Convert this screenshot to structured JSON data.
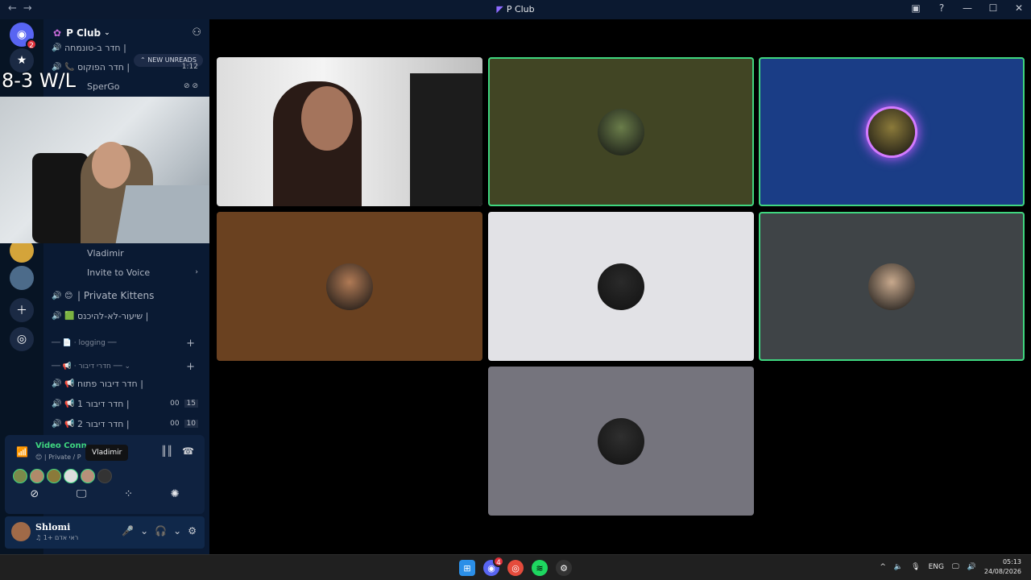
{
  "window": {
    "title": "P Club",
    "logo_icon": "discord-logo-icon"
  },
  "titlebar": {
    "back": "←",
    "forward": "→",
    "inbox_icon": "inbox-icon",
    "help_icon": "help-icon",
    "minimize": "—",
    "maximize": "☐",
    "close": "✕"
  },
  "rail": {
    "home_badge": "2"
  },
  "server": {
    "name": "P Club"
  },
  "new_unreads": "NEW UNREADS",
  "channels_top": [
    {
      "name": "חדר ב-טונמחה |",
      "right": ""
    },
    {
      "name": "חדר הפוקוס |",
      "right": "1:12"
    },
    {
      "name": "SperGo",
      "right": ""
    }
  ],
  "voice_members": [
    {
      "name": "Vladimir"
    },
    {
      "name": "Invite to Voice"
    }
  ],
  "channels_mid": [
    {
      "emoji": "😊",
      "name": "| Private Kittens"
    },
    {
      "emoji": "🟩",
      "name": "שיעור-לא-להיכנס |"
    }
  ],
  "categories": [
    {
      "name": "logging"
    },
    {
      "name": "חדרי דיבור"
    }
  ],
  "channels_bottom": [
    {
      "name": "חדר דיבור פתוח |",
      "a": "",
      "b": ""
    },
    {
      "name": "חדר דיבור 1 |",
      "a": "00",
      "b": "15"
    },
    {
      "name": "חדר דיבור 2 |",
      "a": "00",
      "b": "10"
    }
  ],
  "voice_panel": {
    "title": "Video Conn",
    "subtitle": "😊 | Private / P",
    "tooltip": "Vladimir"
  },
  "user": {
    "name": "Shlomi",
    "status": "♫ ראי אדם +1"
  },
  "overlay": {
    "text": "8-3 W/L"
  },
  "tiles": [
    {
      "type": "camera",
      "bg": "#d8d8d8"
    },
    {
      "type": "avatar",
      "bg": "#414524",
      "speaking": true,
      "avatar_color": "#6a7d4a"
    },
    {
      "type": "avatar",
      "bg": "#1a3d86",
      "speaking": true,
      "ring": true,
      "avatar_color": "#8b7a3a"
    },
    {
      "type": "avatar",
      "bg": "#6a4120",
      "speaking": false,
      "avatar_color": "#b07a55"
    },
    {
      "type": "avatar",
      "bg": "#e2e2e6",
      "speaking": false,
      "avatar_color": "#2a2a2a"
    },
    {
      "type": "avatar",
      "bg": "#3f4447",
      "speaking": true,
      "avatar_color": "#c8a98d"
    },
    {
      "type": "avatar",
      "bg": "#75747d",
      "speaking": false,
      "avatar_color": "#2f2f2f"
    }
  ],
  "taskbar": {
    "discord_badge": "4",
    "language": "ENG",
    "time": "05:13",
    "date": "24/08/2026"
  },
  "colors": {
    "accent_green": "#3fd67f",
    "sidebar": "#0a1a33",
    "rail": "#071424"
  }
}
